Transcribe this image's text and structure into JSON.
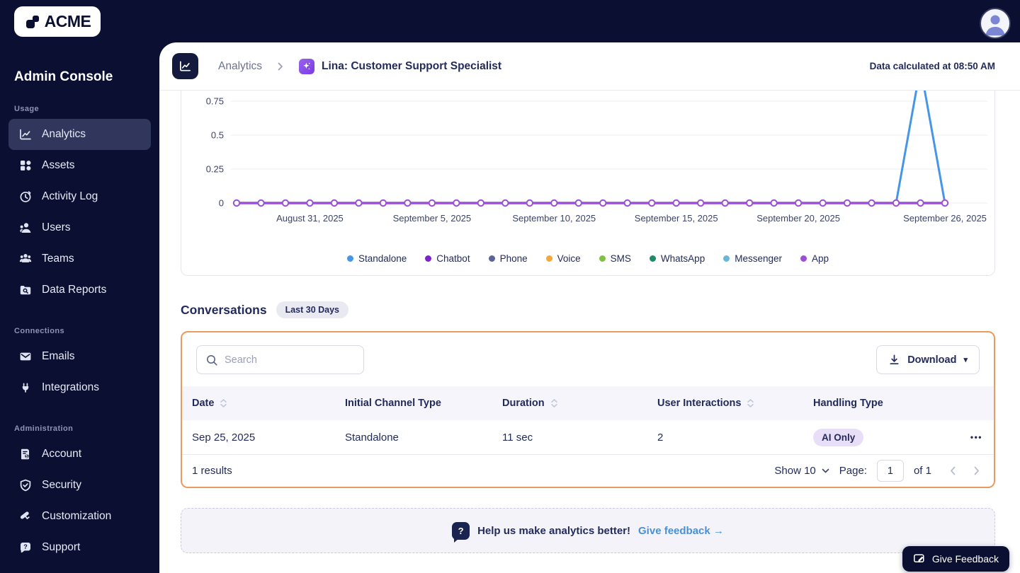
{
  "app": {
    "brand": "ACME",
    "console_title": "Admin Console"
  },
  "sidebar": {
    "sections": [
      {
        "label": "Usage",
        "items": [
          {
            "label": "Analytics",
            "icon": "analytics-chart-icon",
            "active": true
          },
          {
            "label": "Assets",
            "icon": "assets-blocks-icon"
          },
          {
            "label": "Activity Log",
            "icon": "activity-clock-icon"
          },
          {
            "label": "Users",
            "icon": "user-icon"
          },
          {
            "label": "Teams",
            "icon": "teams-icon"
          },
          {
            "label": "Data Reports",
            "icon": "folder-search-icon"
          }
        ]
      },
      {
        "label": "Connections",
        "items": [
          {
            "label": "Emails",
            "icon": "mail-icon"
          },
          {
            "label": "Integrations",
            "icon": "plug-icon"
          }
        ]
      },
      {
        "label": "Administration",
        "items": [
          {
            "label": "Account",
            "icon": "invoice-icon"
          },
          {
            "label": "Security",
            "icon": "shield-check-icon"
          },
          {
            "label": "Customization",
            "icon": "paint-roller-icon"
          },
          {
            "label": "Support",
            "icon": "chat-question-icon"
          }
        ]
      }
    ]
  },
  "header": {
    "breadcrumb_root": "Analytics",
    "breadcrumb_current": "Lina: Customer Support Specialist",
    "calculated_text": "Data calculated at 08:50 AM"
  },
  "chart_data": {
    "type": "line",
    "title": "",
    "xlabel": "",
    "ylabel": "",
    "ylim": [
      0,
      1
    ],
    "yticks": [
      0,
      0.25,
      0.5,
      0.75
    ],
    "ytick_labels": [
      "0",
      "0.25",
      "0.5",
      "0.75"
    ],
    "grid": true,
    "legend_position": "bottom",
    "x": [
      "2025-08-28",
      "2025-08-29",
      "2025-08-30",
      "2025-08-31",
      "2025-09-01",
      "2025-09-02",
      "2025-09-03",
      "2025-09-04",
      "2025-09-05",
      "2025-09-06",
      "2025-09-07",
      "2025-09-08",
      "2025-09-09",
      "2025-09-10",
      "2025-09-11",
      "2025-09-12",
      "2025-09-13",
      "2025-09-14",
      "2025-09-15",
      "2025-09-16",
      "2025-09-17",
      "2025-09-18",
      "2025-09-19",
      "2025-09-20",
      "2025-09-21",
      "2025-09-22",
      "2025-09-23",
      "2025-09-24",
      "2025-09-25",
      "2025-09-26"
    ],
    "x_ticks": [
      {
        "index": 3,
        "label": "August 31, 2025"
      },
      {
        "index": 8,
        "label": "September 5, 2025"
      },
      {
        "index": 13,
        "label": "September 10, 2025"
      },
      {
        "index": 18,
        "label": "September 15, 2025"
      },
      {
        "index": 23,
        "label": "September 20, 2025"
      },
      {
        "index": 29,
        "label": "September 26, 2025"
      }
    ],
    "series": [
      {
        "name": "Standalone",
        "color": "#4596e8",
        "values": [
          0,
          0,
          0,
          0,
          0,
          0,
          0,
          0,
          0,
          0,
          0,
          0,
          0,
          0,
          0,
          0,
          0,
          0,
          0,
          0,
          0,
          0,
          0,
          0,
          0,
          0,
          0,
          0,
          1,
          0
        ]
      },
      {
        "name": "Chatbot",
        "color": "#7e22ce",
        "values": [
          0,
          0,
          0,
          0,
          0,
          0,
          0,
          0,
          0,
          0,
          0,
          0,
          0,
          0,
          0,
          0,
          0,
          0,
          0,
          0,
          0,
          0,
          0,
          0,
          0,
          0,
          0,
          0,
          0,
          0
        ]
      },
      {
        "name": "Phone",
        "color": "#5c6399",
        "values": [
          0,
          0,
          0,
          0,
          0,
          0,
          0,
          0,
          0,
          0,
          0,
          0,
          0,
          0,
          0,
          0,
          0,
          0,
          0,
          0,
          0,
          0,
          0,
          0,
          0,
          0,
          0,
          0,
          0,
          0
        ]
      },
      {
        "name": "Voice",
        "color": "#f2a93b",
        "values": [
          0,
          0,
          0,
          0,
          0,
          0,
          0,
          0,
          0,
          0,
          0,
          0,
          0,
          0,
          0,
          0,
          0,
          0,
          0,
          0,
          0,
          0,
          0,
          0,
          0,
          0,
          0,
          0,
          0,
          0
        ]
      },
      {
        "name": "SMS",
        "color": "#7fc242",
        "values": [
          0,
          0,
          0,
          0,
          0,
          0,
          0,
          0,
          0,
          0,
          0,
          0,
          0,
          0,
          0,
          0,
          0,
          0,
          0,
          0,
          0,
          0,
          0,
          0,
          0,
          0,
          0,
          0,
          0,
          0
        ]
      },
      {
        "name": "WhatsApp",
        "color": "#1f8a66",
        "values": [
          0,
          0,
          0,
          0,
          0,
          0,
          0,
          0,
          0,
          0,
          0,
          0,
          0,
          0,
          0,
          0,
          0,
          0,
          0,
          0,
          0,
          0,
          0,
          0,
          0,
          0,
          0,
          0,
          0,
          0
        ]
      },
      {
        "name": "Messenger",
        "color": "#66b7d9",
        "values": [
          0,
          0,
          0,
          0,
          0,
          0,
          0,
          0,
          0,
          0,
          0,
          0,
          0,
          0,
          0,
          0,
          0,
          0,
          0,
          0,
          0,
          0,
          0,
          0,
          0,
          0,
          0,
          0,
          0,
          0
        ]
      },
      {
        "name": "App",
        "color": "#9b4fd6",
        "values": [
          0,
          0,
          0,
          0,
          0,
          0,
          0,
          0,
          0,
          0,
          0,
          0,
          0,
          0,
          0,
          0,
          0,
          0,
          0,
          0,
          0,
          0,
          0,
          0,
          0,
          0,
          0,
          0,
          0,
          0
        ]
      }
    ]
  },
  "conversations": {
    "title": "Conversations",
    "period_badge": "Last 30 Days",
    "search_placeholder": "Search",
    "download_label": "Download",
    "columns": [
      {
        "label": "Date",
        "sortable": true
      },
      {
        "label": "Initial Channel Type",
        "sortable": false
      },
      {
        "label": "Duration",
        "sortable": true
      },
      {
        "label": "User Interactions",
        "sortable": true
      },
      {
        "label": "Handling Type",
        "sortable": false
      }
    ],
    "rows": [
      {
        "date": "Sep 25, 2025",
        "initial_channel_type": "Standalone",
        "duration": "11 sec",
        "user_interactions": "2",
        "handling_type": "AI Only"
      }
    ],
    "footer": {
      "results_text": "1 results",
      "show_label": "Show 10",
      "page_label": "Page:",
      "page_value": "1",
      "of_text": "of 1"
    }
  },
  "feedback_banner": {
    "message": "Help us make analytics better!",
    "link_text": "Give feedback →"
  },
  "floating_button": {
    "label": "Give Feedback"
  },
  "icons": {
    "ellipsis": "•••",
    "download_caret": "▾",
    "question_mark": "?"
  },
  "colors": {
    "brand_navy": "#0b1033",
    "active_nav_bg": "#30365c",
    "accent_orange": "#eb9b60",
    "link_blue": "#4a90d9",
    "badge_purple_bg": "#e9def8",
    "badge_gray_bg": "#e9e9f2",
    "chart_blue": "#4596e8",
    "chart_purple": "#9b4fd6",
    "header_row_bg": "#f5f5fb"
  }
}
